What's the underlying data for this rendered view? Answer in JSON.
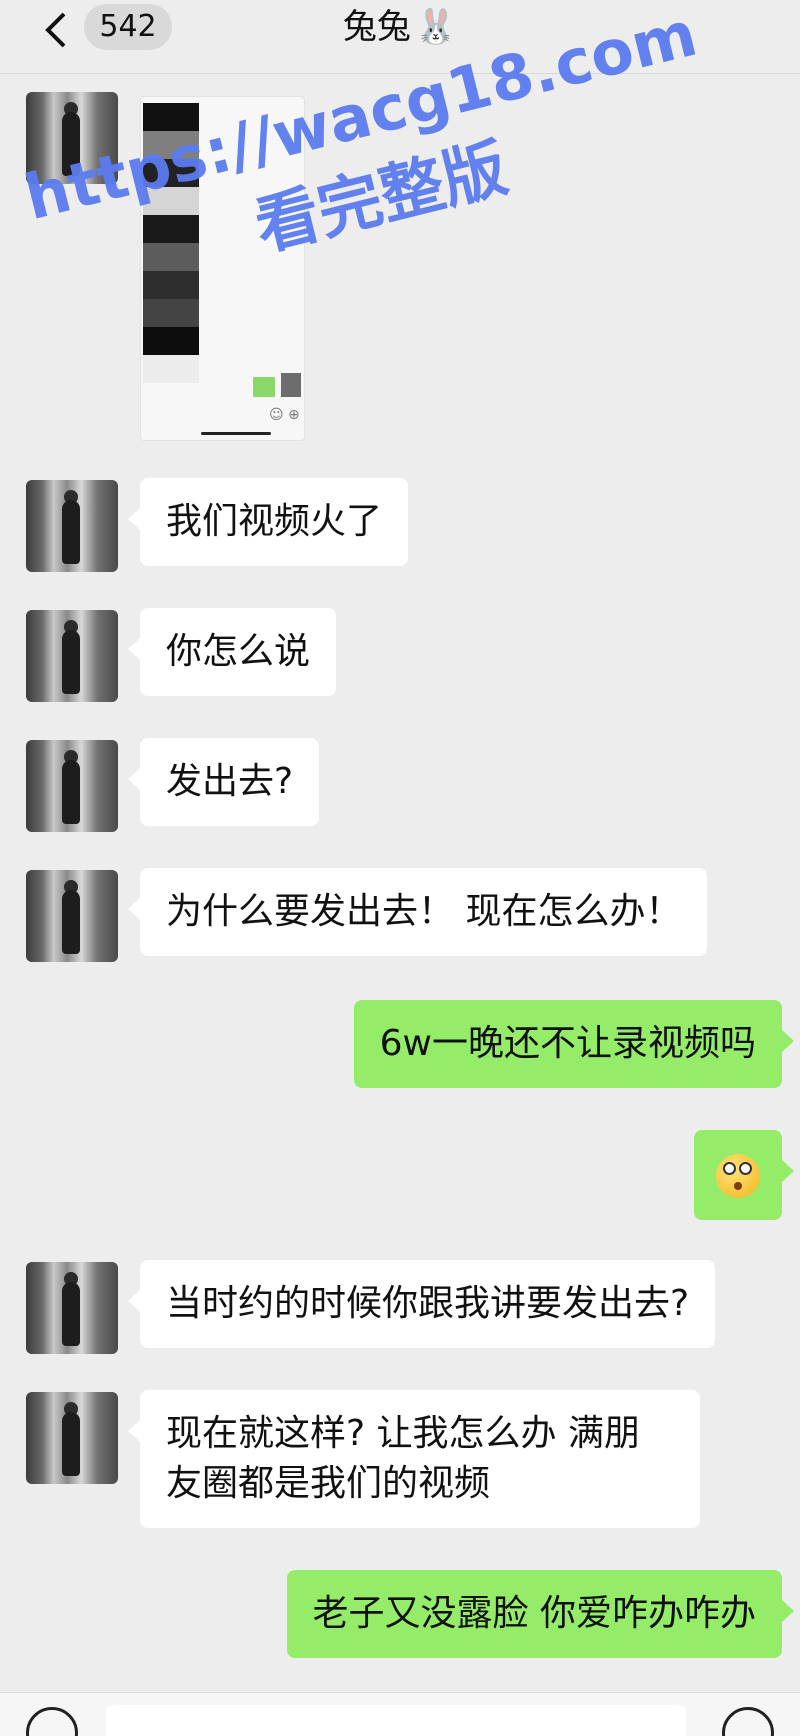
{
  "header": {
    "unread_count": "542",
    "title": "兔兔",
    "title_emoji": "🐰"
  },
  "messages": [
    {
      "side": "left",
      "type": "image"
    },
    {
      "side": "left",
      "text": "我们视频火了"
    },
    {
      "side": "left",
      "text": "你怎么说"
    },
    {
      "side": "left",
      "text": "发出去?"
    },
    {
      "side": "left",
      "text": "为什么要发出去！ 现在怎么办！"
    },
    {
      "side": "right",
      "text": "6w一晚还不让录视频吗"
    },
    {
      "side": "right",
      "type": "emoji",
      "icon": "dizzy-face-emoji"
    },
    {
      "side": "left",
      "text": "当时约的时候你跟我讲要发出去?"
    },
    {
      "side": "left",
      "text": "现在就这样? 让我怎么办 满朋友圈都是我们的视频"
    },
    {
      "side": "right",
      "text": "老子又没露脸 你爱咋办咋办"
    }
  ],
  "watermark": {
    "url": "https://wacg18.com",
    "subtitle": "看完整版"
  },
  "colors": {
    "background": "#ededed",
    "incoming_bubble": "#ffffff",
    "outgoing_bubble": "#95ec69",
    "watermark": "#5b7cf0"
  }
}
